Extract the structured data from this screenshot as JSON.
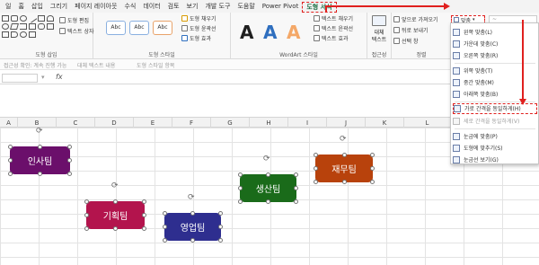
{
  "tabs": [
    {
      "label": "일"
    },
    {
      "label": "홈"
    },
    {
      "label": "삽입"
    },
    {
      "label": "그리기"
    },
    {
      "label": "페이지 레이아웃"
    },
    {
      "label": "수식"
    },
    {
      "label": "데이터"
    },
    {
      "label": "검토"
    },
    {
      "label": "보기"
    },
    {
      "label": "개발 도구"
    },
    {
      "label": "도움말"
    },
    {
      "label": "Power Pivot"
    },
    {
      "label": "도형 서식",
      "active": true
    }
  ],
  "ribbon": {
    "insert_shapes": {
      "label": "도형 삽입",
      "edit_shape": "도형 편집",
      "text_box": "텍스트 상자"
    },
    "shape_styles": {
      "label": "도형 스타일",
      "style_box_text": "Abc",
      "fill": "도형 채우기",
      "outline": "도형 윤곽선",
      "effects": "도형 효과"
    },
    "wordart": {
      "label": "WordArt 스타일",
      "letter": "A",
      "text_fill": "텍스트 채우기",
      "text_outline": "텍스트 윤곽선",
      "text_effects": "텍스트 효과"
    },
    "accessibility": {
      "label": "접근성",
      "alt_text_1": "대체",
      "alt_text_2": "텍스트"
    },
    "arrange": {
      "label": "정렬",
      "bring_forward": "앞으로 가져오기",
      "send_backward": "뒤로 보내기",
      "selection_pane": "선택 창",
      "align": "맞춤",
      "text_direction": "~"
    }
  },
  "subbar": {
    "item1": "접근성 확인: 계속 진행 가능",
    "item2": "대체 텍스트 내용",
    "item3": "도형 스타일 항목"
  },
  "formula": {
    "fx": "fx"
  },
  "columns": [
    "A",
    "B",
    "C",
    "D",
    "E",
    "F",
    "G",
    "H",
    "I",
    "J",
    "K",
    "L"
  ],
  "teams": [
    {
      "name": "인사팀",
      "color": "#6b0f6b"
    },
    {
      "name": "기획팀",
      "color": "#b3144d"
    },
    {
      "name": "영업팀",
      "color": "#2e2e8f"
    },
    {
      "name": "생산팀",
      "color": "#1a6b1a"
    },
    {
      "name": "재무팀",
      "color": "#b8420c"
    }
  ],
  "align_menu": {
    "items": [
      {
        "label": "왼쪽 맞춤(L)",
        "dim": false
      },
      {
        "label": "가운데 맞춤(C)",
        "dim": false
      },
      {
        "label": "오른쪽 맞춤(R)",
        "dim": false
      },
      {
        "label": "위쪽 맞춤(T)",
        "dim": false
      },
      {
        "label": "중간 맞춤(M)",
        "dim": false
      },
      {
        "label": "아래쪽 맞춤(B)",
        "dim": false
      },
      {
        "label": "가로 간격을 동일하게(H)",
        "dim": false,
        "highlight": true
      },
      {
        "label": "세로 간격을 동일하게(V)",
        "dim": true
      },
      {
        "label": "눈금에 맞춤(P)",
        "dim": false
      },
      {
        "label": "도형에 맞추기(S)",
        "dim": false
      },
      {
        "label": "눈금선 보기(G)",
        "dim": false
      }
    ]
  },
  "colors": {
    "accent_red": "#e0201e",
    "excel_green": "#1e7145"
  }
}
